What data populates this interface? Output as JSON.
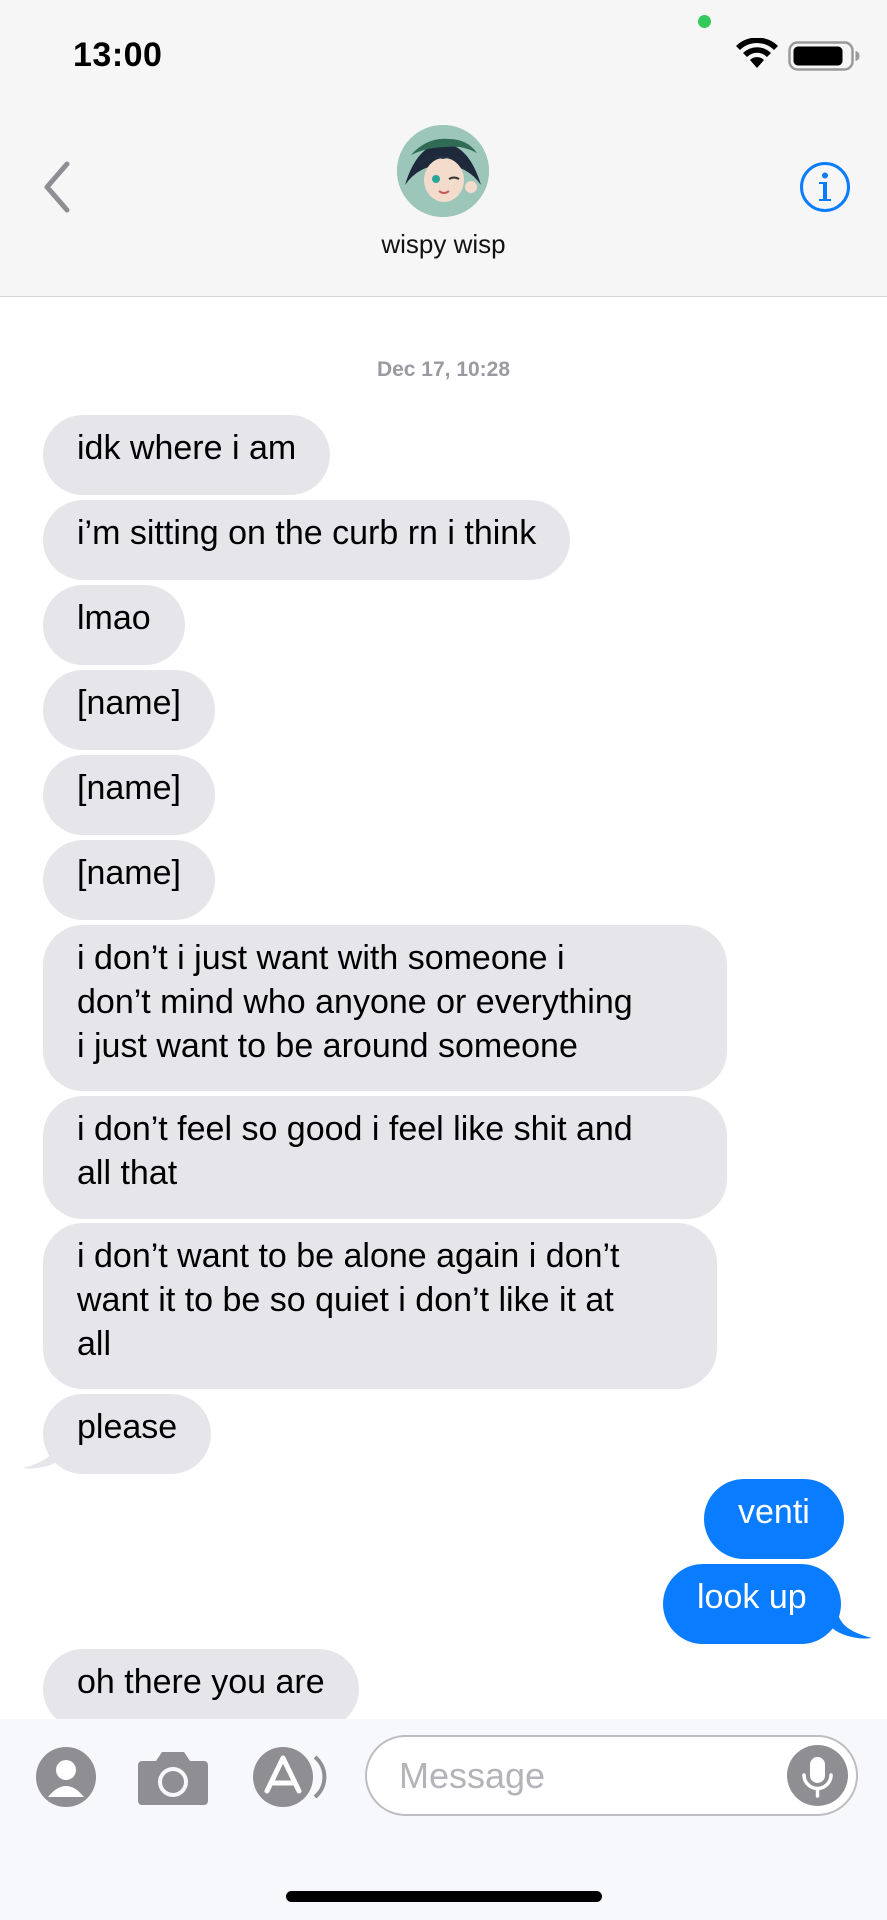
{
  "status_bar": {
    "time": "13:00",
    "mic_dot_color": "#34c759"
  },
  "header": {
    "back_icon": "chevron-left-icon",
    "contact_name": "wispy wisp",
    "info_icon": "info-icon"
  },
  "thread": {
    "timestamp": "Dec 17, 10:28",
    "messages": [
      {
        "from": "them",
        "text": "idk where i am"
      },
      {
        "from": "them",
        "text": "i’m sitting on the curb rn i think"
      },
      {
        "from": "them",
        "text": "lmao"
      },
      {
        "from": "them",
        "text": "[name]"
      },
      {
        "from": "them",
        "text": "[name]"
      },
      {
        "from": "them",
        "text": "[name]"
      },
      {
        "from": "them",
        "lines": [
          "i don’t i just want with someone i",
          "don’t mind who anyone or everything",
          "i just want to be around someone"
        ]
      },
      {
        "from": "them",
        "lines": [
          "i don’t feel so good i feel like shit and",
          "all that"
        ]
      },
      {
        "from": "them",
        "lines": [
          "i don’t want to be alone again i don’t",
          "want it to be so quiet i don’t like it at",
          "all"
        ]
      },
      {
        "from": "them",
        "text": "please"
      },
      {
        "from": "me",
        "text": "venti"
      },
      {
        "from": "me",
        "text": "look up"
      },
      {
        "from": "them",
        "text": "oh there you are"
      }
    ]
  },
  "composer": {
    "contacts_icon": "contact-icon",
    "camera_icon": "camera-icon",
    "appstore_icon": "app-store-icon",
    "placeholder": "Message",
    "voice_icon": "microphone-icon"
  },
  "colors": {
    "sent_bubble": "#0a7cff",
    "received_bubble": "#e6e5ea",
    "accent": "#0a7cff"
  }
}
